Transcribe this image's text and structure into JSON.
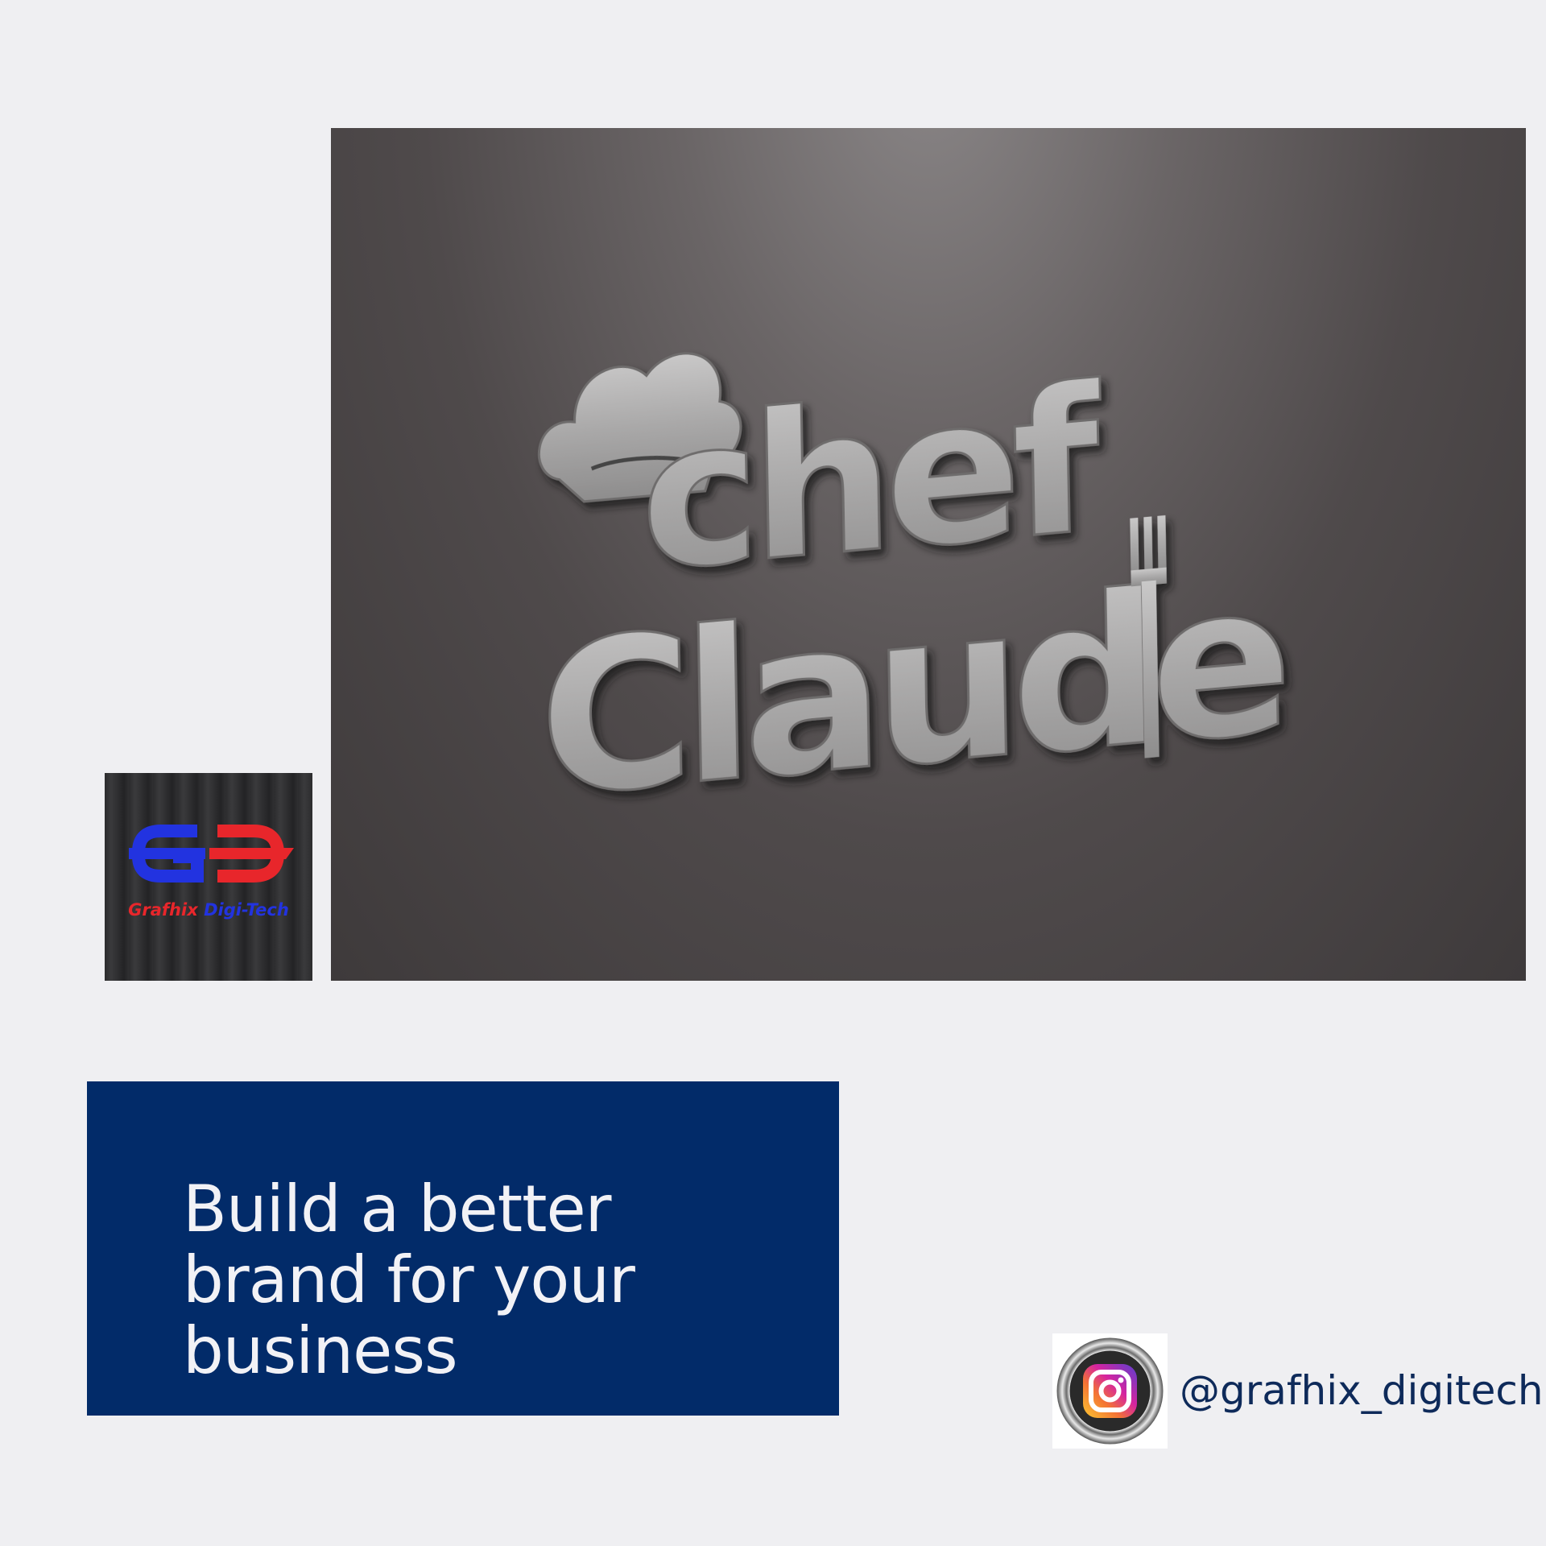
{
  "mockup": {
    "logo_line1": "chef",
    "logo_line2": "Claude"
  },
  "brand": {
    "name_part1": "Grafhix",
    "name_part2": "Digi-Tech",
    "color_red": "#e8262b",
    "color_blue": "#2233e0"
  },
  "tagline": {
    "text": "Build a better brand for your business",
    "box_color": "#022b69"
  },
  "social": {
    "icon": "instagram-icon",
    "handle": "@grafhix_digitech"
  }
}
